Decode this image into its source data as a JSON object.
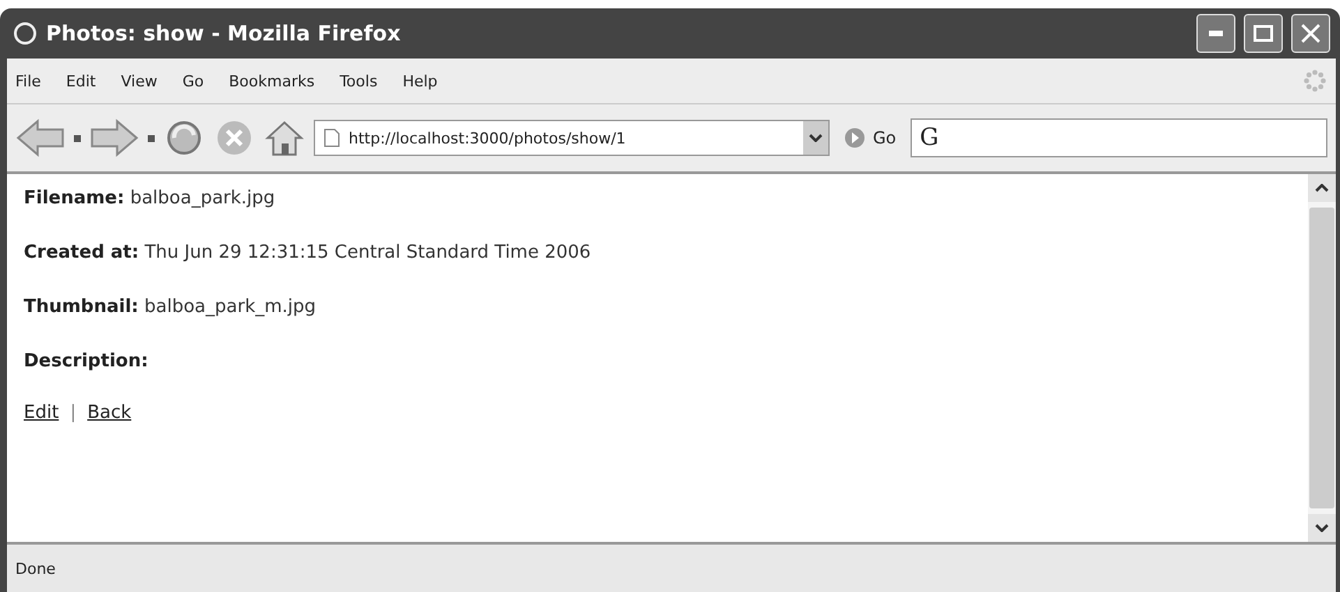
{
  "window": {
    "title": "Photos: show - Mozilla Firefox"
  },
  "menu": [
    "File",
    "Edit",
    "View",
    "Go",
    "Bookmarks",
    "Tools",
    "Help"
  ],
  "toolbar": {
    "url": "http://localhost:3000/photos/show/1",
    "go_label": "Go",
    "search_value": "G"
  },
  "fields": [
    {
      "label": "Filename:",
      "value": "balboa_park.jpg"
    },
    {
      "label": "Created at:",
      "value": "Thu Jun 29 12:31:15 Central Standard Time 2006"
    },
    {
      "label": "Thumbnail:",
      "value": "balboa_park_m.jpg"
    },
    {
      "label": "Description:"
    }
  ],
  "links": [
    {
      "label": "Edit"
    },
    {
      "label": "Back"
    }
  ],
  "link_separator": "|",
  "status_bar": "Done"
}
